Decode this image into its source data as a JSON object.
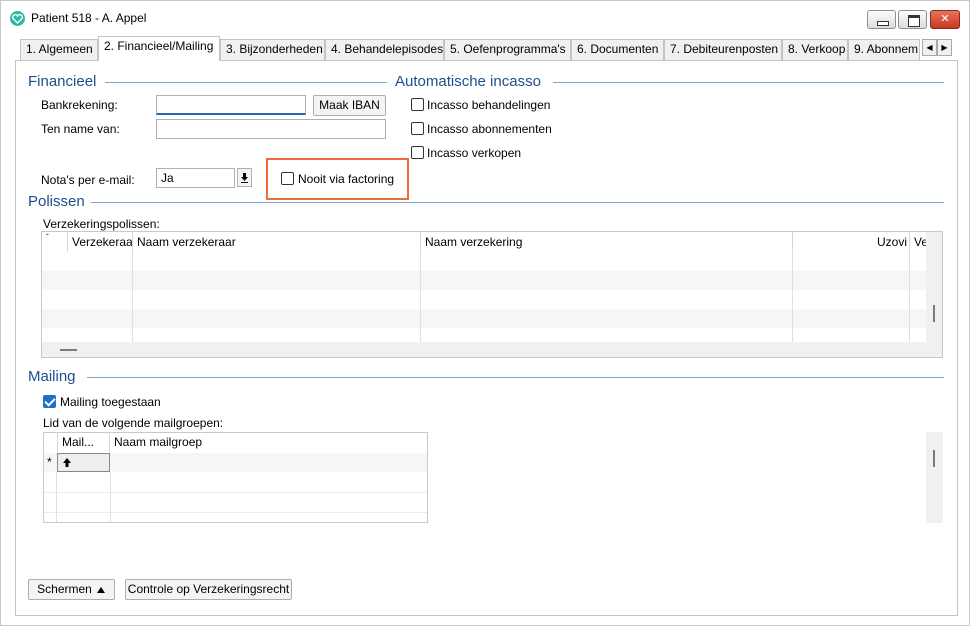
{
  "window": {
    "title": "Patient 518 - A. Appel",
    "controls": {
      "minimize": "",
      "maximize": "",
      "close": "✕"
    }
  },
  "tabs": [
    {
      "label": "1. Algemeen",
      "active": false
    },
    {
      "label": "2. Financieel/Mailing",
      "active": true
    },
    {
      "label": "3. Bijzonderheden",
      "active": false
    },
    {
      "label": "4. Behandelepisodes",
      "active": false
    },
    {
      "label": "5. Oefenprogramma's",
      "active": false
    },
    {
      "label": "6. Documenten",
      "active": false
    },
    {
      "label": "7. Debiteurenposten",
      "active": false
    },
    {
      "label": "8. Verkoop",
      "active": false
    },
    {
      "label": "9. Abonnem",
      "active": false
    }
  ],
  "tab_scroll": {
    "left": "◀",
    "right": "▶"
  },
  "financieel": {
    "title": "Financieel",
    "bankrekening_label": "Bankrekening:",
    "bankrekening_value": "",
    "maak_iban_label": "Maak IBAN",
    "ten_name_van_label": "Ten name van:",
    "ten_name_van_value": "",
    "notas_email_label": "Nota's per e-mail:",
    "notas_email_value": "Ja",
    "nooit_factoring_label": "Nooit via factoring",
    "nooit_factoring_checked": false
  },
  "incasso": {
    "title": "Automatische incasso",
    "options": [
      {
        "label": "Incasso behandelingen",
        "checked": false
      },
      {
        "label": "Incasso abonnementen",
        "checked": false
      },
      {
        "label": "Incasso verkopen",
        "checked": false
      }
    ]
  },
  "polissen": {
    "title": "Polissen",
    "grid_label": "Verzekeringspolissen:",
    "columns": [
      "Verzekeraar",
      "Naam verzekeraar",
      "Naam verzekering",
      "Uzovi",
      "Ve"
    ],
    "rows": []
  },
  "mailing": {
    "title": "Mailing",
    "toegestaan_label": "Mailing toegestaan",
    "toegestaan_checked": true,
    "groepen_label": "Lid van de volgende mailgroepen:",
    "columns": [
      "Mail...",
      "Naam mailgroep"
    ],
    "new_row_marker": "*",
    "rows": []
  },
  "footer": {
    "schermen_label": "Schermen",
    "controle_label": "Controle op Verzekeringsrecht"
  },
  "colors": {
    "accent": "#1f6fc5",
    "group_title": "#1e4e8c",
    "highlight": "#ef6b3a",
    "app_icon": "#2fb9a4"
  }
}
